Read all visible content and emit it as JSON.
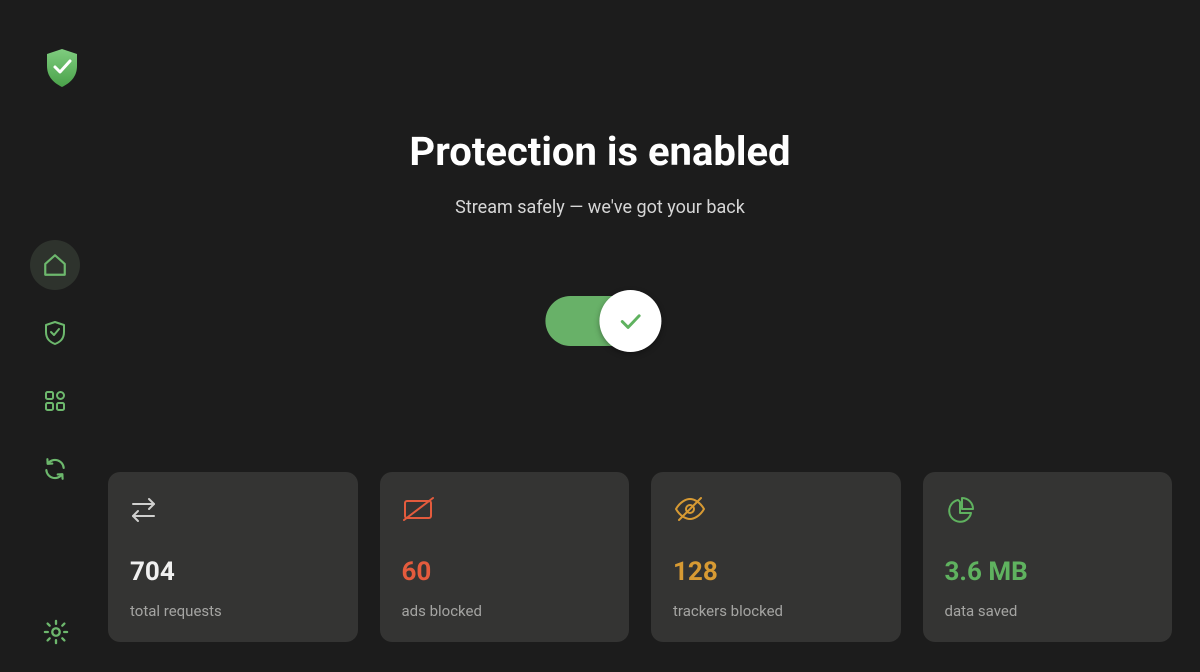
{
  "colors": {
    "bg": "#1c1c1c",
    "card": "#343433",
    "green": "#5fb25f",
    "red": "#e45b3d",
    "amber": "#d79a33"
  },
  "hero": {
    "title": "Protection is enabled",
    "subtitle": "Stream safely — we've got your back"
  },
  "toggle": {
    "enabled": true
  },
  "nav": {
    "items": [
      {
        "name": "home",
        "active": true
      },
      {
        "name": "shield",
        "active": false
      },
      {
        "name": "apps",
        "active": false
      },
      {
        "name": "refresh",
        "active": false
      }
    ]
  },
  "stats": [
    {
      "icon": "arrows",
      "value": "704",
      "label": "total requests",
      "color": "white"
    },
    {
      "icon": "ad-block",
      "value": "60",
      "label": "ads blocked",
      "color": "red"
    },
    {
      "icon": "eye-slash",
      "value": "128",
      "label": "trackers blocked",
      "color": "amber"
    },
    {
      "icon": "pie",
      "value": "3.6 MB",
      "label": "data saved",
      "color": "green"
    }
  ]
}
